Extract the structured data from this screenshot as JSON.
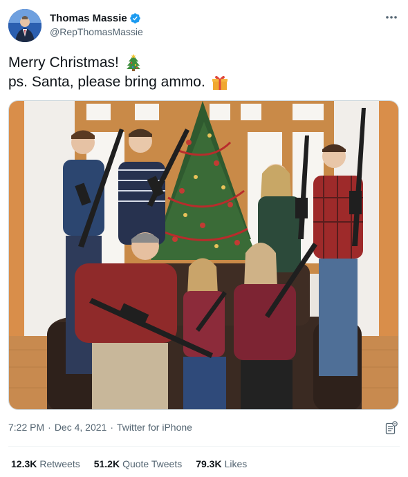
{
  "author": {
    "display_name": "Thomas Massie",
    "handle": "@RepThomasMassie",
    "verified": true,
    "avatar_icon": "avatar-photo"
  },
  "tweet": {
    "line1": "Merry Christmas!",
    "line1_emoji": "christmas-tree-emoji",
    "line2": "ps. Santa, please bring ammo.",
    "line2_emoji": "wrapped-gift-emoji"
  },
  "meta": {
    "time": "7:22 PM",
    "date": "Dec 4, 2021",
    "source": "Twitter for iPhone",
    "separator": "·"
  },
  "stats": {
    "retweets_count": "12.3K",
    "retweets_label": "Retweets",
    "quotes_count": "51.2K",
    "quotes_label": "Quote Tweets",
    "likes_count": "79.3K",
    "likes_label": "Likes"
  },
  "colors": {
    "text_primary": "#0f1419",
    "text_secondary": "#536471",
    "verified_blue": "#1d9bf0",
    "divider": "#eff3f4"
  }
}
